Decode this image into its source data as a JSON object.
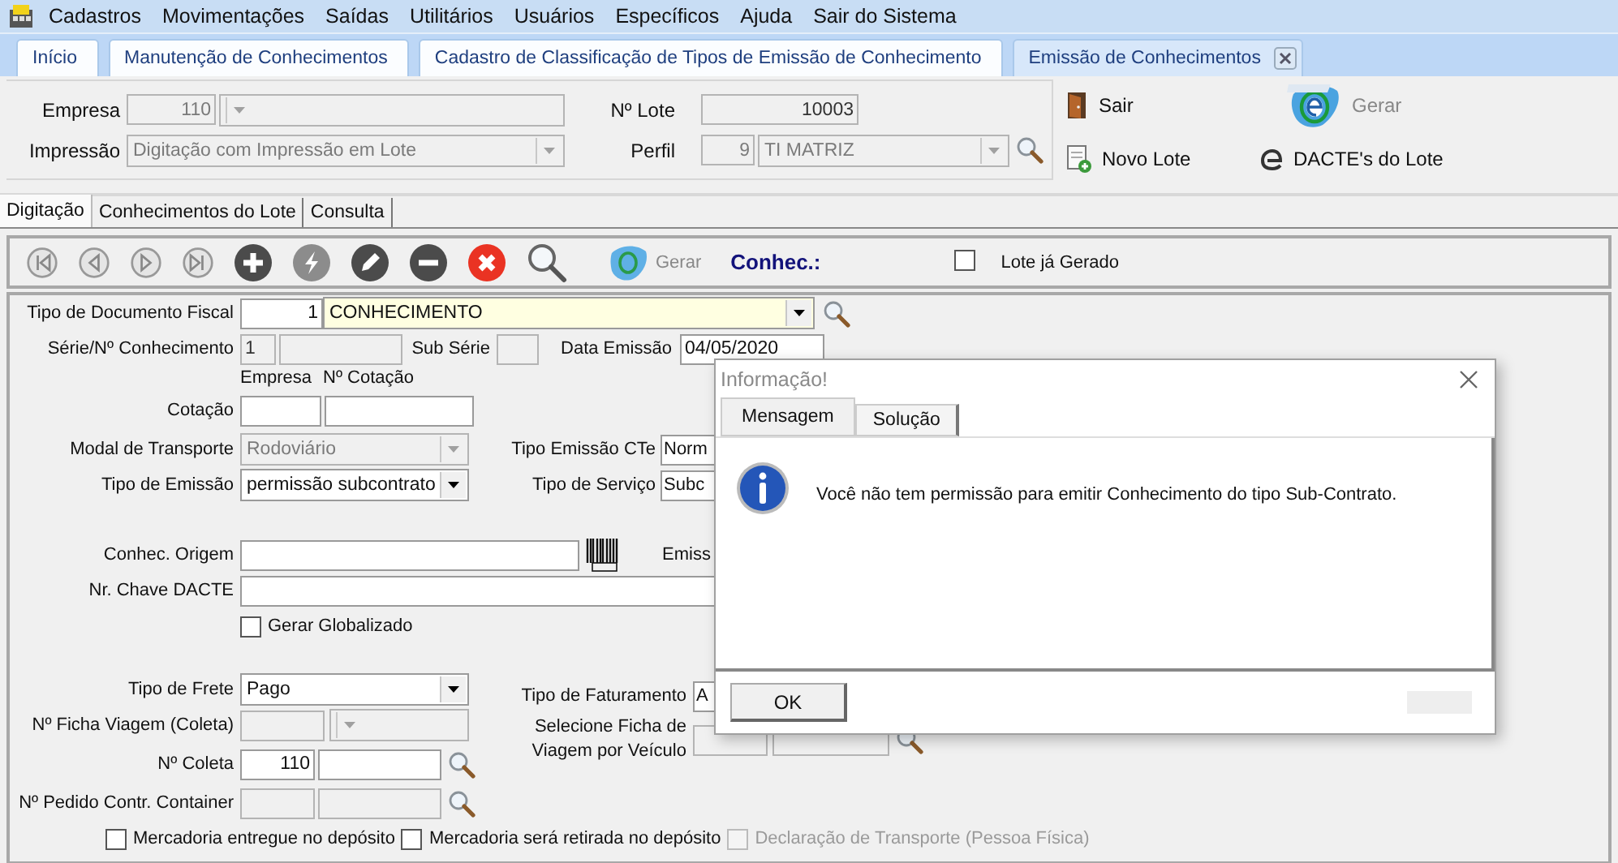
{
  "menu": [
    "Cadastros",
    "Movimentações",
    "Saídas",
    "Utilitários",
    "Usuários",
    "Específicos",
    "Ajuda",
    "Sair do Sistema"
  ],
  "doc_tabs": [
    {
      "label": "Início",
      "selected": false
    },
    {
      "label": "Manutenção de Conhecimentos",
      "selected": false
    },
    {
      "label": "Cadastro de Classificação de Tipos de Emissão de Conhecimento",
      "selected": false
    },
    {
      "label": "Emissão de Conhecimentos",
      "selected": true,
      "closable": true
    }
  ],
  "header": {
    "empresa_label": "Empresa",
    "empresa_code": "110",
    "lote_label": "Nº Lote",
    "lote_value": "10003",
    "impressao_label": "Impressão",
    "impressao_value": "Digitação com Impressão em Lote",
    "perfil_label": "Perfil",
    "perfil_code": "9",
    "perfil_value": "TI MATRIZ"
  },
  "actions": [
    {
      "label": "Sair",
      "kind": "exit",
      "disabled": false
    },
    {
      "label": "Gerar",
      "kind": "mdfe",
      "disabled": true
    },
    {
      "label": "Novo Lote",
      "kind": "new",
      "disabled": false
    },
    {
      "label": "DACTE's do Lote",
      "kind": "dacte",
      "disabled": false
    }
  ],
  "sub_tabs": [
    {
      "label": "Digitação",
      "selected": true
    },
    {
      "label": "Conhecimentos do Lote",
      "selected": false
    },
    {
      "label": "Consulta",
      "selected": false
    }
  ],
  "toolbar": {
    "buttons": [
      {
        "kind": "first",
        "disabled": true
      },
      {
        "kind": "prev",
        "disabled": true
      },
      {
        "kind": "next",
        "disabled": true
      },
      {
        "kind": "last",
        "disabled": true
      },
      {
        "kind": "add",
        "disabled": false
      },
      {
        "kind": "bolt",
        "disabled": true
      },
      {
        "kind": "edit",
        "disabled": false
      },
      {
        "kind": "remove",
        "disabled": false
      },
      {
        "kind": "cancel",
        "disabled": false
      },
      {
        "kind": "search",
        "disabled": false
      }
    ],
    "gerar": {
      "label": "Gerar",
      "disabled": true
    },
    "conhec_label": "Conhec.:",
    "lote_gerado": {
      "label": "Lote já Gerado",
      "checked": false
    }
  },
  "form": {
    "tipo_documento": {
      "label": "Tipo de Documento Fiscal",
      "code": "1",
      "value": "CONHECIMENTO"
    },
    "serie": {
      "label": "Série/Nº Conhecimento",
      "value": "1"
    },
    "sub_serie": {
      "label": "Sub Série"
    },
    "data_emissao": {
      "label": "Data Emissão",
      "value": "04/05/2020"
    },
    "cotacao_captions": [
      "Empresa",
      "Nº Cotação"
    ],
    "cotacao": {
      "label": "Cotação"
    },
    "modal": {
      "label": "Modal de Transporte",
      "value": "Rodoviário",
      "disabled": true
    },
    "tipo_emissao_cte": {
      "label": "Tipo Emissão CTe",
      "value": "Norm"
    },
    "tipo_emissao": {
      "label": "Tipo de Emissão",
      "value": "permissão subcontrato",
      "disabled": false
    },
    "tipo_servico": {
      "label": "Tipo de Serviço",
      "value": "Subc"
    },
    "conhec_origem": {
      "label": "Conhec. Origem"
    },
    "emissao": {
      "label": "Emiss"
    },
    "chave_dacte": {
      "label": "Nr. Chave DACTE"
    },
    "gerar_globalizado": {
      "label": "Gerar Globalizado",
      "checked": false
    },
    "tipo_frete": {
      "label": "Tipo de Frete",
      "value": "Pago",
      "disabled": false
    },
    "tipo_faturamento": {
      "label": "Tipo de Faturamento",
      "value": "A"
    },
    "ficha_viagem": {
      "label": "Nº Ficha Viagem (Coleta)",
      "disabled": true
    },
    "selecione_ficha": {
      "label": "Selecione Ficha de Viagem por Veículo"
    },
    "coleta": {
      "label": "Nº Coleta",
      "value": "110"
    },
    "pedido": {
      "label": "Nº Pedido Contr. Container",
      "disabled": true
    },
    "checks": [
      {
        "label": "Mercadoria entregue no depósito",
        "checked": false,
        "disabled": false
      },
      {
        "label": "Mercadoria será retirada no depósito",
        "checked": false,
        "disabled": false
      },
      {
        "label": "Declaração de Transporte (Pessoa Física)",
        "checked": false,
        "disabled": true
      }
    ]
  },
  "dialog": {
    "title": "Informação!",
    "tabs": [
      {
        "label": "Mensagem",
        "selected": true
      },
      {
        "label": "Solução",
        "selected": false
      }
    ],
    "message": "Você não tem permissão para emitir Conhecimento do tipo Sub-Contrato.",
    "ok": "OK"
  }
}
